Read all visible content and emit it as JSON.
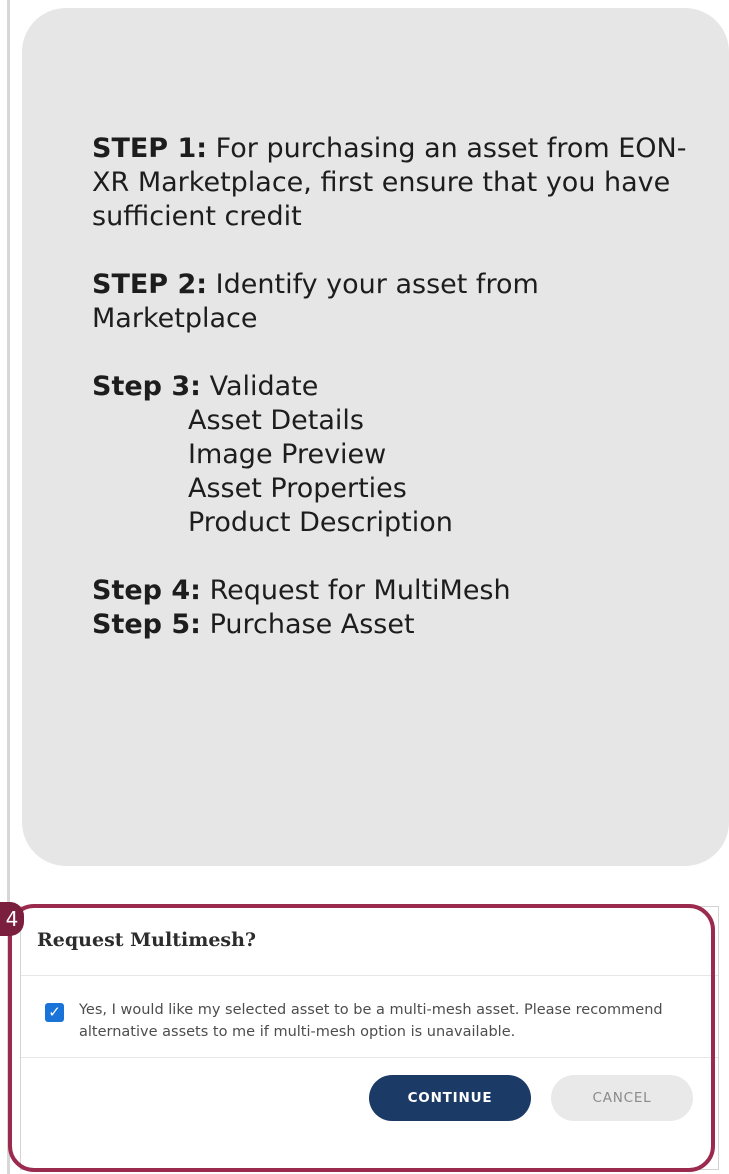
{
  "steps": {
    "step1": {
      "label": "STEP 1:",
      "text": " For purchasing an asset from EON-XR Marketplace, first ensure that you have sufficient credit"
    },
    "step2": {
      "label": "STEP 2:",
      "text": " Identify your asset from Marketplace"
    },
    "step3": {
      "label": "Step 3:",
      "text": " Validate",
      "items": [
        "Asset Details",
        "Image Preview",
        "Asset Properties",
        "Product Description"
      ]
    },
    "step4": {
      "label": "Step 4:",
      "text": " Request for MultiMesh"
    },
    "step5": {
      "label": "Step 5:",
      "text": " Purchase Asset"
    }
  },
  "callout": {
    "number": "4"
  },
  "dialog": {
    "title": "Request Multimesh?",
    "checkbox_checked": true,
    "message": "Yes, I would like my selected asset to be a multi-mesh asset. Please recommend alternative assets to me if multi-mesh option is unavailable.",
    "continue_label": "CONTINUE",
    "cancel_label": "CANCEL"
  },
  "colors": {
    "card_bg": "#e6e6e6",
    "highlight": "#9a2b4e",
    "primary_button": "#1c3a66",
    "checkbox": "#1a73d9"
  }
}
